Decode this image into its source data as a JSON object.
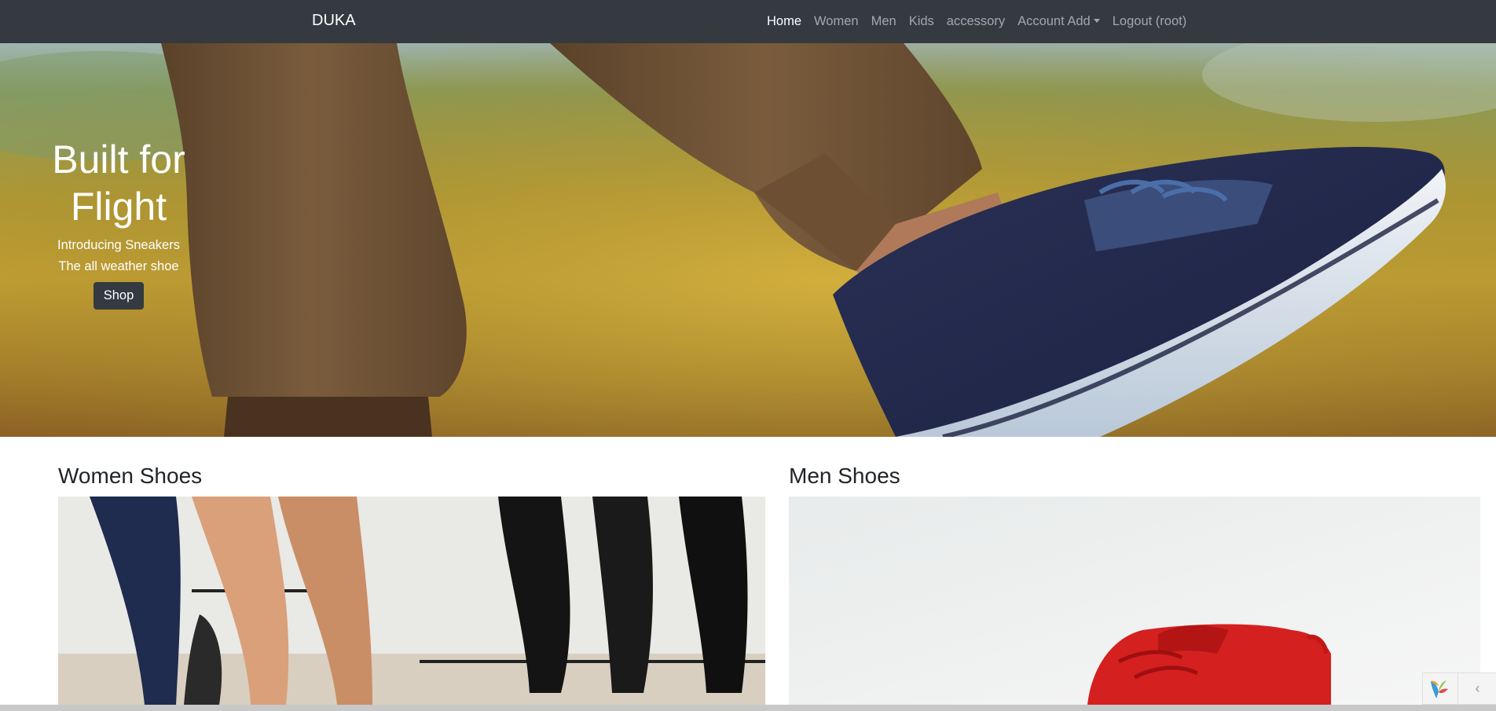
{
  "navbar": {
    "brand": "DUKA",
    "items": [
      {
        "label": "Home",
        "active": true
      },
      {
        "label": "Women",
        "active": false
      },
      {
        "label": "Men",
        "active": false
      },
      {
        "label": "Kids",
        "active": false
      },
      {
        "label": "accessory",
        "active": false
      },
      {
        "label": "Account Add",
        "active": false,
        "dropdown": true
      },
      {
        "label": "Logout (root)",
        "active": false
      }
    ]
  },
  "hero": {
    "title": "Built for Flight",
    "line1": "Introducing Sneakers",
    "line2": "The all weather shoe",
    "button": "Shop"
  },
  "sections": {
    "women": {
      "title": "Women Shoes"
    },
    "men": {
      "title": "Men Shoes"
    }
  },
  "debug_toolbar": {
    "toggle_icon": "chevron-left-icon",
    "toggle_glyph": "‹"
  },
  "colors": {
    "navbar_bg": "#343a40",
    "nav_active": "#ffffff",
    "nav_inactive": "rgba(255,255,255,0.55)",
    "button_bg": "#343a40"
  }
}
